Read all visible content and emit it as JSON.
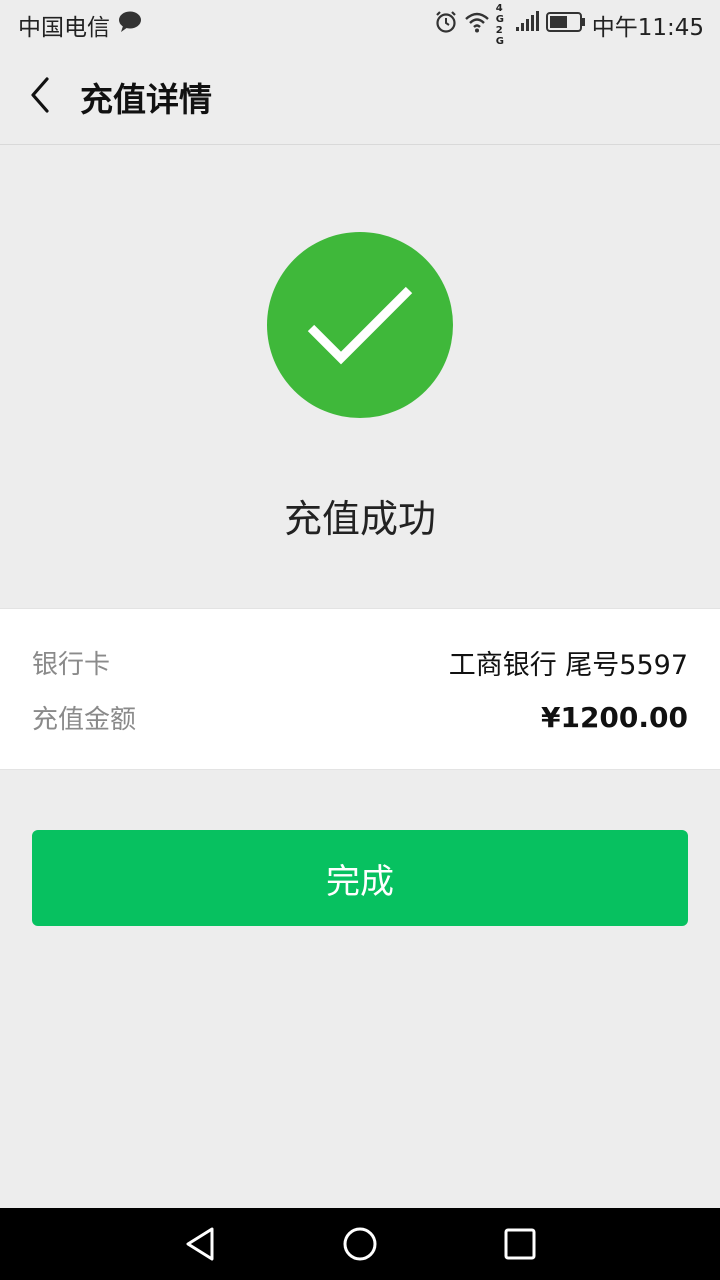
{
  "status_bar": {
    "carrier": "中国电信",
    "network": "4G 2G",
    "time": "中午11:45",
    "icons": [
      "chat-bubble-icon",
      "alarm-icon",
      "wifi-icon",
      "signal-icon",
      "battery-icon"
    ]
  },
  "nav": {
    "title": "充值详情",
    "back_icon": "chevron-left-icon"
  },
  "result": {
    "icon": "checkmark-circle-icon",
    "text": "充值成功",
    "color": "#3fb83a"
  },
  "details": {
    "bank_label": "银行卡",
    "bank_value": "工商银行 尾号5597",
    "amount_label": "充值金额",
    "amount_value": "¥1200.00"
  },
  "actions": {
    "done_label": "完成",
    "accent": "#07c160"
  },
  "system_nav": [
    "back-triangle-icon",
    "home-circle-icon",
    "recents-square-icon"
  ]
}
